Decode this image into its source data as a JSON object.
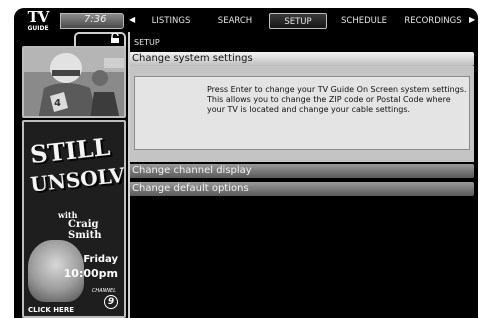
{
  "logo": {
    "tv": "TV",
    "guide": "GUIDE"
  },
  "clock": "7:36",
  "nav": {
    "items": [
      {
        "label": "LISTINGS"
      },
      {
        "label": "SEARCH"
      },
      {
        "label": "SETUP",
        "active": true
      },
      {
        "label": "SCHEDULE"
      },
      {
        "label": "RECORDINGS"
      }
    ]
  },
  "icons": {
    "lock": "lock-icon",
    "left_arrow": "left-arrow-icon",
    "right_arrow": "right-arrow-icon"
  },
  "promo": {
    "ad_line1": "STILL",
    "ad_line2": "UNSOLVED",
    "ad_with": "with",
    "ad_host": "Craig Smith",
    "ad_day": "Friday",
    "ad_time": "10:00pm",
    "ad_channel_word": "CHANNEL",
    "ad_channel_num": "9",
    "click_here": "CLICK HERE"
  },
  "main": {
    "section": "SETUP",
    "menu": [
      {
        "label": "Change system settings"
      },
      {
        "label": "Change channel display"
      },
      {
        "label": "Change default options"
      }
    ],
    "description": "Press Enter to change your TV Guide On Screen system settings. This allows you to change the ZIP code or Postal Code where your TV is located and change your cable settings."
  }
}
